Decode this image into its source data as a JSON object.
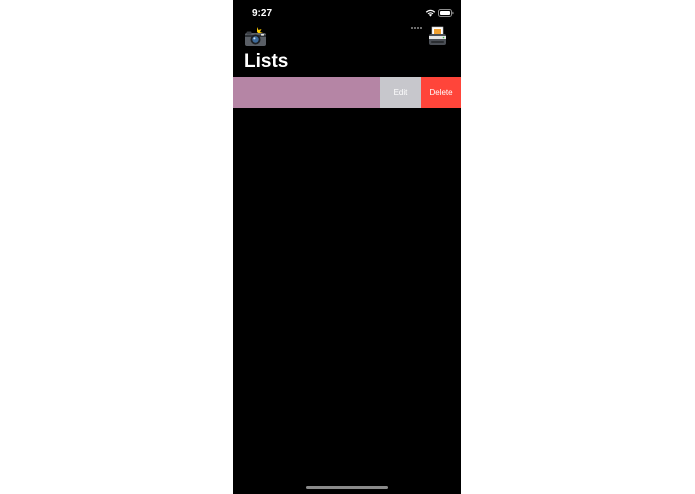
{
  "status_bar": {
    "time": "9:27",
    "icons": [
      "signal-icon",
      "wifi-icon",
      "battery-icon"
    ]
  },
  "nav_bar": {
    "left_icon": "camera-flash-icon",
    "right_icon": "scanner-icon"
  },
  "page": {
    "title": "Lists"
  },
  "list": {
    "rows": [
      {
        "label": "",
        "color": "#b585a5",
        "swipe_actions": [
          {
            "label": "Edit",
            "color": "#c7c7cc"
          },
          {
            "label": "Delete",
            "color": "#ff453a"
          }
        ]
      }
    ]
  },
  "colors": {
    "background": "#000000",
    "text": "#ffffff",
    "row_color": "#b585a5",
    "edit_action": "#c7c7cc",
    "delete_action": "#ff453a",
    "home_indicator": "#8a8a8a"
  }
}
